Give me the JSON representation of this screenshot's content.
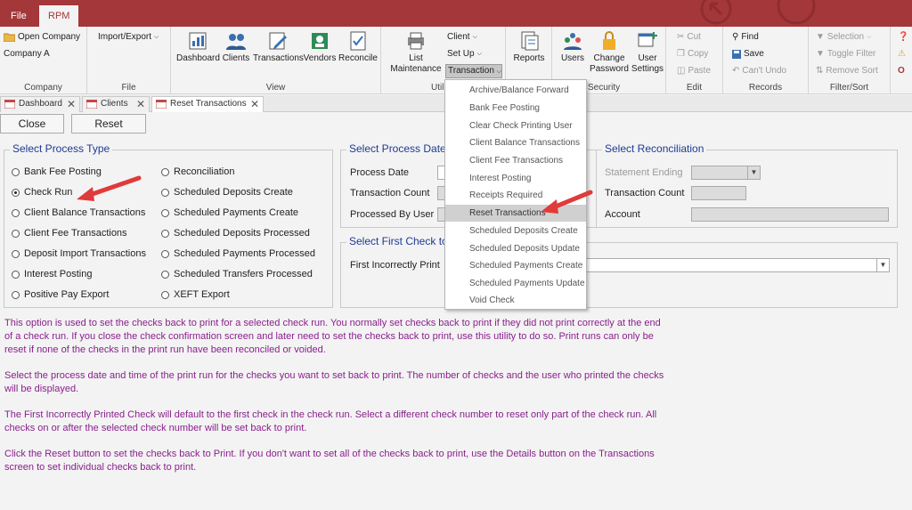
{
  "titlebar": {
    "tabs": [
      "File",
      "RPM"
    ]
  },
  "ribbon": {
    "company": {
      "open_company": "Open Company",
      "company_name": "Company A",
      "label": "Company"
    },
    "file": {
      "import_export": "Import/Export",
      "label": "File"
    },
    "view": {
      "items": [
        "Dashboard",
        "Clients",
        "Transactions",
        "Vendors",
        "Reconcile"
      ],
      "label": "View"
    },
    "util": {
      "list": "List",
      "maintenance": "Maintenance",
      "client": "Client",
      "setup": "Set Up",
      "transaction": "Transaction",
      "label": "Util"
    },
    "reports": {
      "label_btn": "Reports"
    },
    "security": {
      "users": "Users",
      "change": "Change",
      "password": "Password",
      "user": "User",
      "settings": "Settings",
      "label": "Security"
    },
    "edit": {
      "cut": "Cut",
      "copy": "Copy",
      "paste": "Paste",
      "label": "Edit"
    },
    "records": {
      "find": "Find",
      "save": "Save",
      "undo": "Can't Undo",
      "label": "Records"
    },
    "filter": {
      "selection": "Selection",
      "toggle": "Toggle Filter",
      "remove": "Remove Sort",
      "label": "Filter/Sort"
    }
  },
  "doctabs": [
    "Dashboard",
    "Clients",
    "Reset Transactions"
  ],
  "buttons": {
    "close": "Close",
    "reset": "Reset"
  },
  "process_type": {
    "legend": "Select Process Type",
    "left": [
      "Bank Fee Posting",
      "Check Run",
      "Client Balance Transactions",
      "Client Fee Transactions",
      "Deposit Import Transactions",
      "Interest Posting",
      "Positive Pay Export"
    ],
    "right": [
      "Reconciliation",
      "Scheduled Deposits Create",
      "Scheduled Payments Create",
      "Scheduled Deposits Processed",
      "Scheduled Payments Processed",
      "Scheduled Transfers Processed",
      "XEFT Export"
    ],
    "selected": "Check Run"
  },
  "process_date": {
    "legend": "Select Process Date",
    "date": "Process Date",
    "count": "Transaction Count",
    "by": "Processed By User"
  },
  "reconciliation": {
    "legend": "Select Reconciliation",
    "ending": "Statement Ending",
    "count": "Transaction Count",
    "account": "Account"
  },
  "first_check": {
    "legend": "Select First Check to",
    "label": "First Incorrectly Print"
  },
  "menu": {
    "items": [
      "Archive/Balance Forward",
      "Bank Fee Posting",
      "Clear Check Printing User",
      "Client Balance Transactions",
      "Client Fee Transactions",
      "Interest Posting",
      "Receipts Required",
      "Reset Transactions",
      "Scheduled Deposits Create",
      "Scheduled Deposits Update",
      "Scheduled Payments Create",
      "Scheduled Payments Update",
      "Void Check"
    ],
    "highlighted": "Reset Transactions"
  },
  "description": {
    "p1": [
      "This option is used to set the checks back to print for a selected check run. You normally set checks back to print if they did not print correctly at the end",
      "of a check run. If you close the check confirmation screen and later need to set the checks back to print, use this utility to do so. Print runs can only be",
      "reset if none of the checks in the print run have been reconciled or voided."
    ],
    "p2": [
      "Select the process date and time of the print run for the checks you want to set back to print. The number of checks and the user who printed the checks",
      "will be displayed."
    ],
    "p3": [
      "The First Incorrectly Printed Check will default to the first check in the check run. Select a different check number to reset only part of the check run. All",
      "checks on or after the selected check number will be set back to print."
    ],
    "p4": [
      "Click the Reset button to set the checks back to Print. If you don't want to set all of the checks back to print, use the Details button on the Transactions",
      "screen to set individual checks back to print."
    ]
  },
  "colors": {
    "title_bar": "#a4373a",
    "legend": "#1f3a93",
    "description": "#8a1f8d",
    "arrow": "#e03a3a"
  }
}
